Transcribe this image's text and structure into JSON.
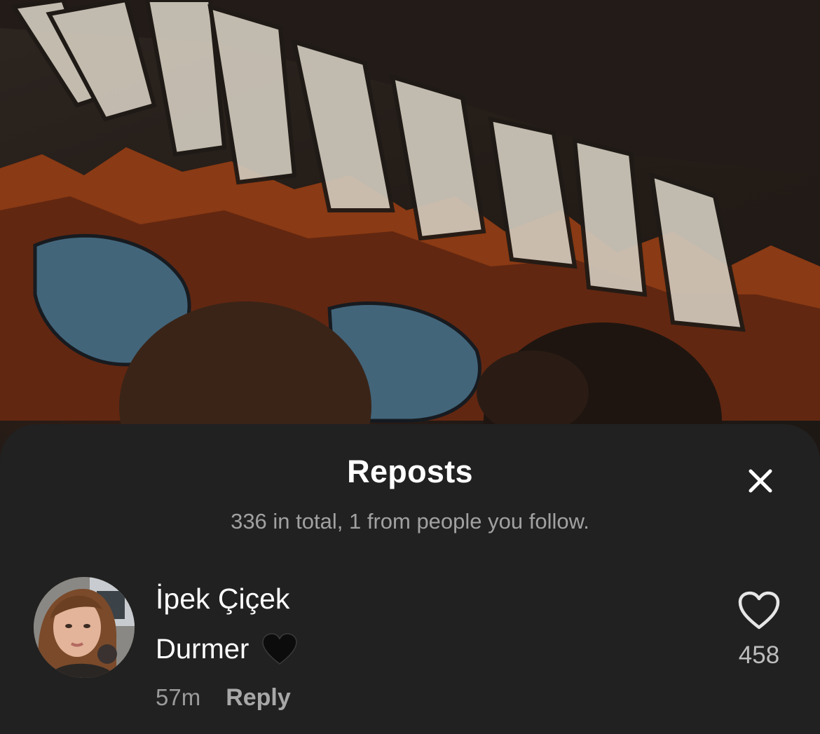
{
  "sheet": {
    "title": "Reposts",
    "subtitle": "336 in total, 1 from people you follow."
  },
  "icons": {
    "close": "close-icon",
    "like": "heart-outline-icon",
    "emoji": "black-heart-emoji"
  },
  "comment": {
    "username": "İpek Çiçek",
    "text": "Durmer",
    "timestamp": "57m",
    "reply_label": "Reply",
    "like_count": "458"
  },
  "colors": {
    "sheet_bg": "#212121",
    "title": "#ffffff",
    "subtitle": "#a1a1a1",
    "meta": "#9a9a9a"
  }
}
